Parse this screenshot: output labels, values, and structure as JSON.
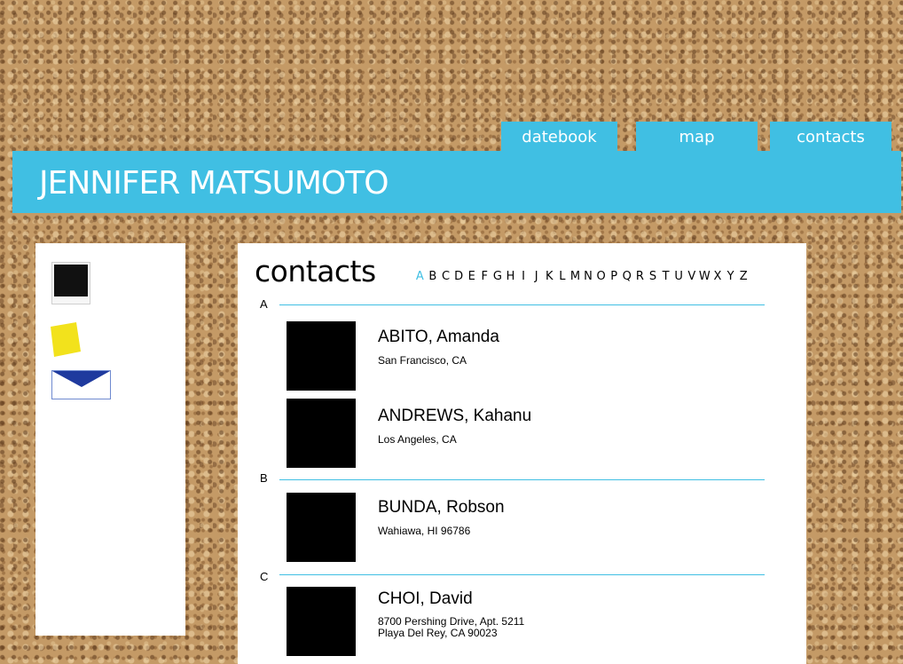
{
  "nav": {
    "tabs": [
      {
        "label": "datebook"
      },
      {
        "label": "map"
      },
      {
        "label": "contacts"
      }
    ]
  },
  "banner": {
    "title": "JENNIFER MATSUMOTO"
  },
  "sidebar": {
    "items": [
      {
        "icon": "photo-frame-icon"
      },
      {
        "icon": "sticky-note-icon"
      },
      {
        "icon": "envelope-icon"
      }
    ]
  },
  "main": {
    "heading": "contacts",
    "alphabet": [
      "A",
      "B",
      "C",
      "D",
      "E",
      "F",
      "G",
      "H",
      "I",
      "J",
      "K",
      "L",
      "M",
      "N",
      "O",
      "P",
      "Q",
      "R",
      "S",
      "T",
      "U",
      "V",
      "W",
      "X",
      "Y",
      "Z"
    ],
    "active_letter": "A",
    "sections": [
      {
        "letter": "A",
        "contacts": [
          {
            "name": "ABITO, Amanda",
            "address": "San Francisco, CA"
          },
          {
            "name": "ANDREWS, Kahanu",
            "address": "Los Angeles, CA"
          }
        ]
      },
      {
        "letter": "B",
        "contacts": [
          {
            "name": "BUNDA, Robson",
            "address": "Wahiawa, HI 96786"
          }
        ]
      },
      {
        "letter": "C",
        "contacts": [
          {
            "name": "CHOI, David",
            "address": "8700 Pershing Drive, Apt. 5211",
            "address2": "Playa Del Rey, CA 90023"
          }
        ]
      }
    ]
  },
  "colors": {
    "accent": "#40bfe3",
    "sticky": "#f2e21c",
    "envelope": "#1f3a9e"
  }
}
